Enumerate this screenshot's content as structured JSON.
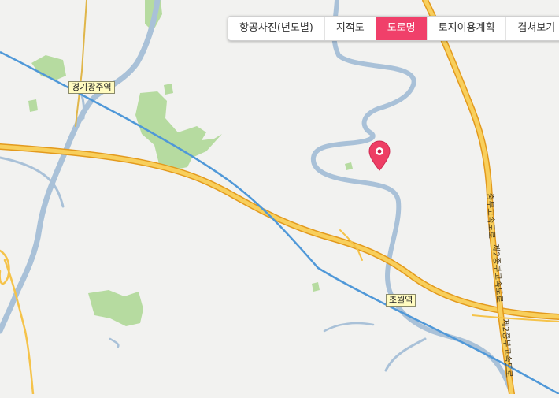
{
  "layer_tabs": [
    {
      "label": "항공사진(년도별)",
      "active": false
    },
    {
      "label": "지적도",
      "active": false
    },
    {
      "label": "도로명",
      "active": true
    },
    {
      "label": "토지이용계획",
      "active": false
    },
    {
      "label": "겹쳐보기",
      "active": false
    }
  ],
  "stations": {
    "gyeonggi_gwangju": "경기광주역",
    "chowol": "초월역"
  },
  "road_labels": {
    "expressway": "중부고속도로",
    "second_expressway": "제2중부고속도로"
  },
  "colors": {
    "active_tab": "#f0406a",
    "river": "#a9c1d8",
    "park": "#b6dba0",
    "expressway": "#f2b72e",
    "rail": "#4f98d8",
    "marker": "#ee3e64"
  },
  "icons": {
    "marker": "location-pin-icon"
  }
}
